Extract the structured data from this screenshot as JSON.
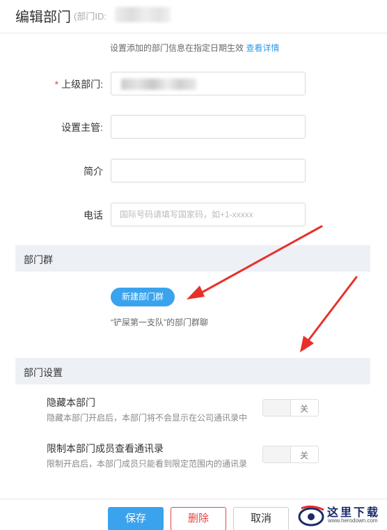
{
  "header": {
    "title": "编辑部门",
    "id_label": "(部门ID:"
  },
  "notice": {
    "text": "设置添加的部门信息在指定日期生效",
    "link": "查看详情"
  },
  "form": {
    "parent_label": "上级部门:",
    "manager_label": "设置主管:",
    "intro_label": "简介",
    "phone_label": "电话",
    "phone_placeholder": "国际号码请填写国家码，如+1-xxxxx"
  },
  "section_group": {
    "title": "部门群",
    "new_group_button": "新建部门群",
    "group_desc": "“铲屎第一支队”的部门群聊"
  },
  "section_settings": {
    "title": "部门设置",
    "hide": {
      "title": "隐藏本部门",
      "desc": "隐藏本部门开启后，本部门将不会显示在公司通讯录中",
      "toggle_label": "关"
    },
    "restrict": {
      "title": "限制本部门成员查看通讯录",
      "desc": "限制开启后，本部门成员只能看到限定范围内的通讯录",
      "toggle_label": "关"
    }
  },
  "footer": {
    "save": "保存",
    "delete": "删除",
    "cancel": "取消"
  },
  "watermark": {
    "text": "这里下载",
    "url": "www.herodown.com"
  },
  "colors": {
    "accent": "#3aa3ee",
    "danger": "#e64340",
    "section_bg": "#edf0f5",
    "annotation_arrow": "#e8302a"
  }
}
